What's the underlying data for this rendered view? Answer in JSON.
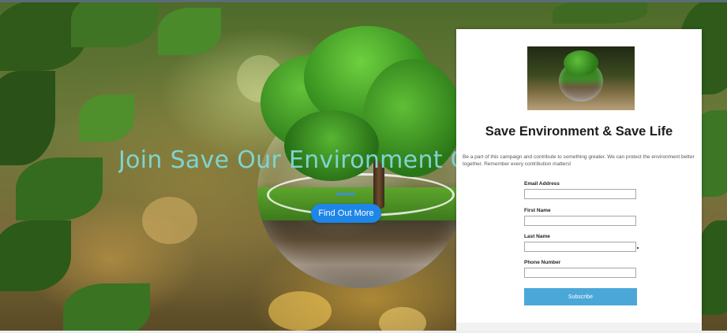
{
  "hero": {
    "title": "Join Save Our Environment Campaign",
    "cta_label": "Find Out More"
  },
  "signup": {
    "title": "Save Environment & Save Life",
    "description": "Be a part of this campaign and contribute to something greater. We can protect the environment better together. Remember every contribution matters!",
    "fields": [
      {
        "label": "Email Address",
        "value": ""
      },
      {
        "label": "First Name",
        "value": ""
      },
      {
        "label": "Last Name",
        "value": ""
      },
      {
        "label": "Phone Number",
        "value": ""
      }
    ],
    "submit_label": "Subscribe"
  },
  "colors": {
    "hero_title": "#7ed4d0",
    "cta_button": "#1e86e8",
    "subscribe_button": "#4ba7d8"
  }
}
